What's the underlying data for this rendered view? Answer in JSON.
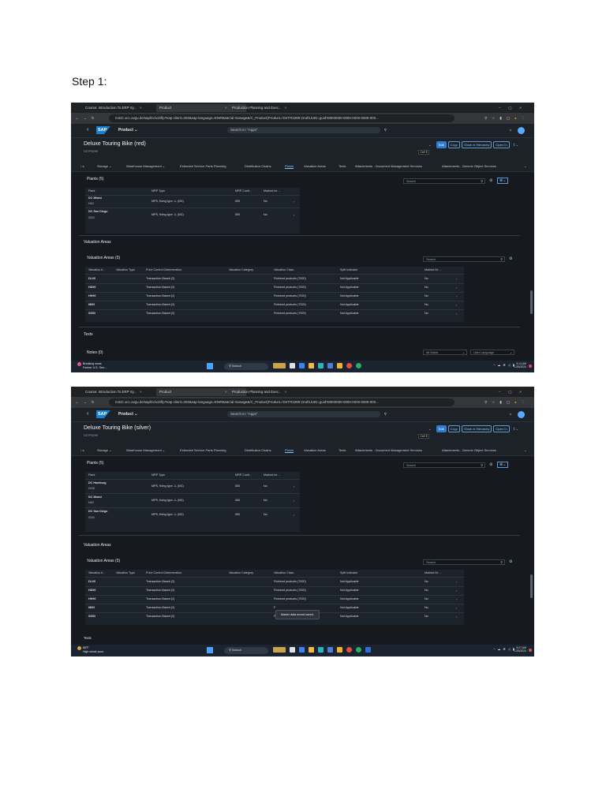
{
  "step_label": "Step 1:",
  "shots": [
    {
      "browser": {
        "tabs": [
          "Course: Introduction To ERP Sy...",
          "Product",
          "Production Planning and Exec..."
        ],
        "url": "m32z.ucc.ovgu.de/sap/bc/ui2/flp?sap-client=203&sap-language=EN#Material-manage&/C_Product(Product='DXTR3299',DraftUUID=guid'00000000-0000-0000-0000-000..."
      },
      "shell": {
        "back": "‹",
        "logo": "SAP",
        "app": "Product ⌄",
        "search_placeholder": "Search In: \"Apps\""
      },
      "header": {
        "title": "Deluxe Touring Bike (red)",
        "id": "DXTR3299",
        "buttons": [
          "Edit",
          "Copy",
          "Show in Hierarchy",
          "Open In"
        ],
        "shortcut": "Ctrl+E"
      },
      "anchors": [
        "Storage ⌄",
        "Warehouse Management ⌄",
        "Extended Service Parts Planning",
        "Distribution Chains",
        "Plants",
        "Valuation Areas",
        "Texts",
        "Attachments - Document Management Services",
        "Attachments - Generic Object Services"
      ],
      "plants": {
        "title": "Plants (5)",
        "search": "Search",
        "columns": [
          "Plant",
          "MRP Type",
          "MRP Contr...",
          "Marked for ..."
        ],
        "rows": [
          {
            "name": "DC Miami",
            "code": "MI00",
            "mrp": "MPS, fixing type -1- (M1)",
            "ctrl": "000",
            "marked": "No"
          },
          {
            "name": "DC San Diego",
            "code": "SD00",
            "mrp": "MPS, fixing type -1- (M1)",
            "ctrl": "000",
            "marked": "No"
          }
        ]
      },
      "valuation": {
        "section": "Valuation Areas",
        "title": "Valuation Areas (5)",
        "search": "Search",
        "columns": [
          "Valuation A...",
          "Valuation Type",
          "Price Control Determination",
          "Valuation Category",
          "Valuation Class",
          "Split Indicator",
          "Marked for ..."
        ],
        "rows": [
          {
            "area": "DL00",
            "pcd": "Transaction-Based (2)",
            "cls": "Finished products (7920)",
            "split": "Not Applicable",
            "marked": "No"
          },
          {
            "area": "HD00",
            "pcd": "Transaction-Based (2)",
            "cls": "Finished products (7920)",
            "split": "Not Applicable",
            "marked": "No"
          },
          {
            "area": "HH00",
            "pcd": "Transaction-Based (2)",
            "cls": "Finished products (7920)",
            "split": "Not Applicable",
            "marked": "No"
          },
          {
            "area": "MI00",
            "pcd": "Transaction-Based (2)",
            "cls": "Finished products (7920)",
            "split": "Not Applicable",
            "marked": "No"
          },
          {
            "area": "SD00",
            "pcd": "Transaction-Based (2)",
            "cls": "Finished products (7920)",
            "split": "Not Applicable",
            "marked": "No"
          }
        ]
      },
      "texts": {
        "section": "Texts",
        "notes": "Notes (0)",
        "filter1": "All Notes",
        "filter2": "User Language"
      },
      "taskbar": {
        "weather1": "Breaking news",
        "weather2": "Former U.S. Sen...",
        "search": "Search",
        "time": "5:14 AM",
        "date": "1/30/2024"
      }
    },
    {
      "browser": {
        "tabs": [
          "Course: Introduction To ERP Sy...",
          "Product",
          "Production Planning and Exec..."
        ],
        "url": "m32z.ucc.ovgu.de/sap/bc/ui2/flp?sap-client=203&sap-language=EN#Material-manage&/C_Product(Product='DXTR3299',DraftUUID=guid'00000000-0000-0000-0000-000..."
      },
      "shell": {
        "back": "‹",
        "logo": "SAP",
        "app": "Product ⌄",
        "search_placeholder": "Search In: \"Apps\""
      },
      "header": {
        "title": "Deluxe Touring Bike (silver)",
        "id": "DXTR3299",
        "buttons": [
          "Edit",
          "Copy",
          "Show in Hierarchy",
          "Open In"
        ],
        "shortcut": "Ctrl+E"
      },
      "anchors": [
        "Storage ⌄",
        "Warehouse Management ⌄",
        "Extended Service Parts Planning",
        "Distribution Chains",
        "Plants",
        "Valuation Areas",
        "Texts",
        "Attachments - Document Management Services",
        "Attachments - Generic Object Services"
      ],
      "plants": {
        "title": "Plants (5)",
        "search": "Search",
        "columns": [
          "Plant",
          "MRP Type",
          "MRP Contr...",
          "Marked for ..."
        ],
        "rows": [
          {
            "name": "DC Hamburg",
            "code": "HH00",
            "mrp": "MPS, fixing type -1- (M1)",
            "ctrl": "000",
            "marked": "No"
          },
          {
            "name": "DC Miami",
            "code": "MI00",
            "mrp": "MPS, fixing type -1- (M1)",
            "ctrl": "000",
            "marked": "No"
          },
          {
            "name": "DC San Diego",
            "code": "SD00",
            "mrp": "MPS, fixing type -1- (M1)",
            "ctrl": "000",
            "marked": "No"
          }
        ]
      },
      "valuation": {
        "section": "Valuation Areas",
        "title": "Valuation Areas (5)",
        "search": "Search",
        "columns": [
          "Valuation A...",
          "Valuation Type",
          "Price Control Determination",
          "Valuation Category",
          "Valuation Class",
          "Split Indicator",
          "Marked for ..."
        ],
        "rows": [
          {
            "area": "DL00",
            "pcd": "Transaction-Based (2)",
            "cls": "Finished products (7920)",
            "split": "Not Applicable",
            "marked": "No"
          },
          {
            "area": "HD00",
            "pcd": "Transaction-Based (2)",
            "cls": "Finished products (7920)",
            "split": "Not Applicable",
            "marked": "No"
          },
          {
            "area": "HH00",
            "pcd": "Transaction-Based (2)",
            "cls": "Finished products (7920)",
            "split": "Not Applicable",
            "marked": "No"
          },
          {
            "area": "MI00",
            "pcd": "Transaction-Based (2)",
            "cls": "F",
            "split": "Not Applicable",
            "marked": "No"
          },
          {
            "area": "SD00",
            "pcd": "Transaction-Based (2)",
            "cls": "F",
            "split": "Not Applicable",
            "marked": "No"
          }
        ]
      },
      "toast": "Master data record saved.",
      "texts": {
        "section": "Texts"
      },
      "taskbar": {
        "weather1": "68°F",
        "weather2": "High winds soon",
        "search": "Search",
        "time": "5:27 AM",
        "date": "1/30/2024"
      }
    }
  ]
}
